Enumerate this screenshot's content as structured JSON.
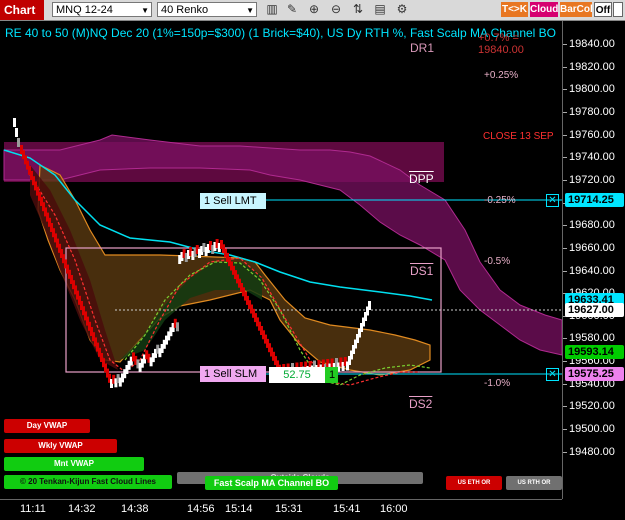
{
  "toolbar": {
    "chart_tab": "Chart",
    "instrument": "MNQ 12-24",
    "bar_type": "40 Renko",
    "tk_label": "T<>K",
    "cloud_label": "Cloud",
    "barcol_label": "BarCol",
    "off_label": "Off",
    "icons": [
      "bar-style-icon",
      "drawing-tools-icon",
      "zoom-in-icon",
      "zoom-out-icon",
      "trade-icon",
      "data-box-icon",
      "properties-icon"
    ]
  },
  "chart": {
    "title": "RE 40 to 50 (M)NQ Dec 20 (1%=150p=$300) (1 Brick=$40), US Dy RTH %, Fast Scalp MA Channel BO",
    "level_top": "+0.7% = 19840.00",
    "dr1": "DR1",
    "plus025": "+0.25%",
    "close_label": "CLOSE 13 SEP",
    "dpp": "DPP",
    "minus025": "-0.25%",
    "minus05": "-0.5%",
    "ds1": "DS1",
    "minus10": "-1.0%",
    "ds2": "DS2",
    "sell_lmt": "1 Sell LMT",
    "sell_slm": "1 Sell SLM",
    "slm_value": "52.75",
    "slm_qty": "1",
    "day_vwap": "Day VWAP",
    "wkly_vwap": "Wkly VWAP",
    "mnt_vwap": "Mnt VWAP",
    "kijun_lines": "Tenkan-Kijun Fast Cloud Lines",
    "kijun_prefix": "© 20",
    "outside_clouds": "Outside Clouds",
    "fast_scalp": "Fast Scalp MA Channel BO",
    "us_eth_or": "US ETH OR",
    "us_rth_or": "US RTH OR"
  },
  "price_axis": {
    "labels": [
      "19840.00",
      "19820.00",
      "19800.00",
      "19780.00",
      "19760.00",
      "19740.00",
      "19720.00",
      "19700.00",
      "19680.00",
      "19660.00",
      "19640.00",
      "19620.00",
      "19600.00",
      "19580.00",
      "19560.00",
      "19540.00",
      "19520.00",
      "19500.00",
      "19480.00"
    ],
    "tag_sell_lmt": "19714.25",
    "tag_partial": "19633.41",
    "tag_last": "19627.00",
    "tag_green": "19593.14",
    "tag_slm": "19575.25"
  },
  "time_axis": {
    "labels": [
      "11:11",
      "14:32",
      "14:38",
      "14:56",
      "15:14",
      "15:31",
      "15:41",
      "16:00"
    ]
  },
  "colors": {
    "toolbar_bg": "#d9d9d9",
    "chart_tab": "#c00000",
    "title": "#00e5ff",
    "up_brick": "#ffffff",
    "down_brick": "#dd0000",
    "cloud_magenta": "#8a1060",
    "vwap_day": "#cc0000",
    "vwap_mnt": "#11cc11",
    "sell_lmt_tag": "#00e5ff",
    "sell_slm_tag": "#ee82ee",
    "green_tag": "#00cc00"
  }
}
